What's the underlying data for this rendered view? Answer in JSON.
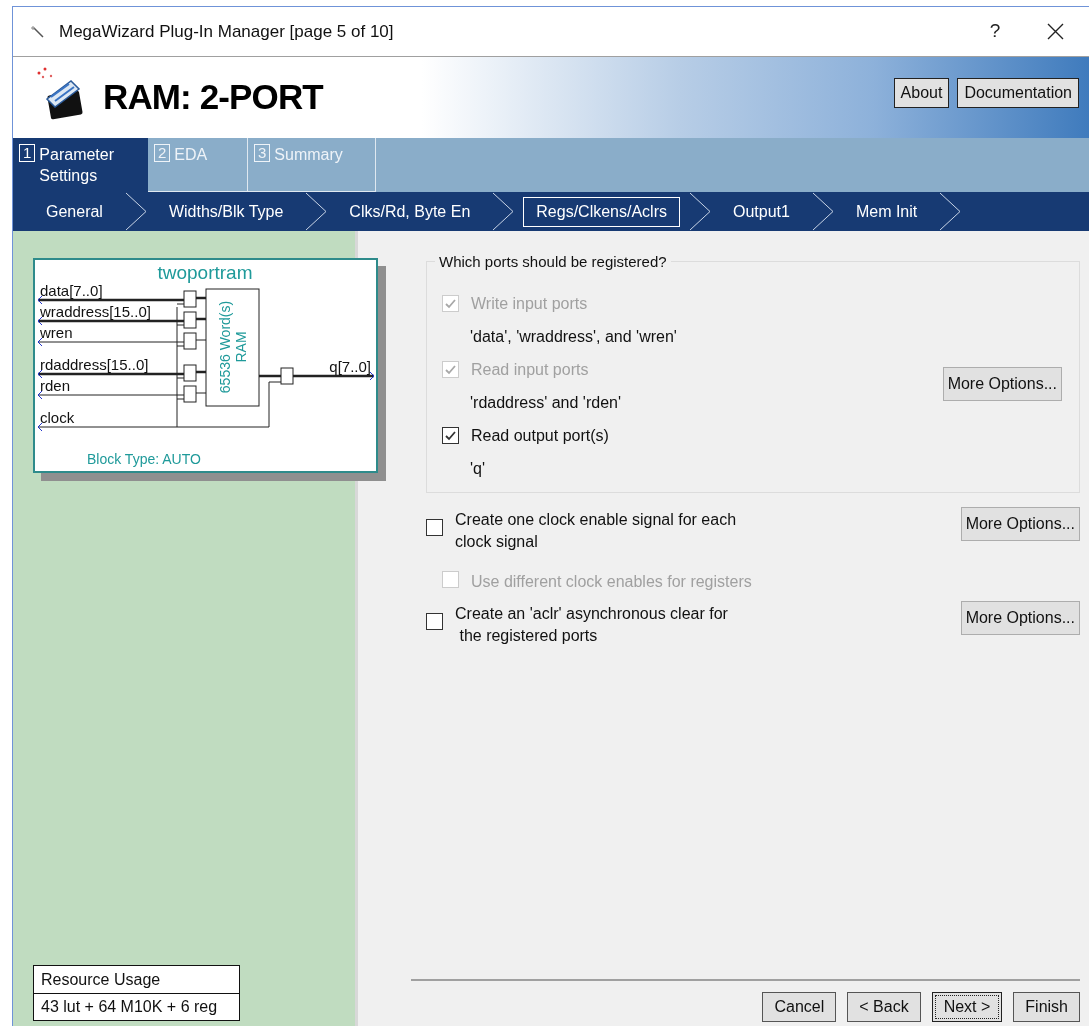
{
  "window": {
    "title": "MegaWizard Plug-In Manager [page 5 of 10]",
    "help": "?"
  },
  "header": {
    "title": "RAM: 2-PORT",
    "buttons": [
      "About",
      "Documentation"
    ]
  },
  "tabs": [
    {
      "number": "1",
      "label": "Parameter Settings",
      "selected": true
    },
    {
      "number": "2",
      "label": "EDA",
      "selected": false
    },
    {
      "number": "3",
      "label": "Summary",
      "selected": false
    }
  ],
  "steps": [
    {
      "label": "General",
      "selected": false
    },
    {
      "label": "Widths/Blk Type",
      "selected": false
    },
    {
      "label": "Clks/Rd, Byte En",
      "selected": false
    },
    {
      "label": "Regs/Clkens/Aclrs",
      "selected": true
    },
    {
      "label": "Output1",
      "selected": false
    },
    {
      "label": "Mem Init",
      "selected": false
    }
  ],
  "diagram": {
    "title": "twoportram",
    "inputs": [
      {
        "label": "data[7..0]",
        "kind": "bus"
      },
      {
        "label": "wraddress[15..0]",
        "kind": "bus"
      },
      {
        "label": "wren",
        "kind": "control"
      },
      {
        "label": "rdaddress[15..0]",
        "kind": "bus"
      },
      {
        "label": "rden",
        "kind": "control"
      },
      {
        "label": "clock",
        "kind": "clock"
      }
    ],
    "output": "q[7..0]",
    "ram_lines": [
      "65536 Word(s)",
      "RAM"
    ],
    "block_type": "Block Type: AUTO"
  },
  "registered_group": {
    "title": "Which ports should be registered?",
    "options": [
      {
        "label": "Write input ports",
        "checked": true,
        "disabled": true,
        "detail": "'data', 'wraddress', and 'wren'"
      },
      {
        "label": "Read input ports",
        "checked": true,
        "disabled": true,
        "detail": "'rdaddress' and 'rden'"
      },
      {
        "label": "Read output port(s)",
        "checked": true,
        "disabled": false,
        "detail": "'q'"
      }
    ],
    "button": "More Options..."
  },
  "options": [
    {
      "kind": "main",
      "lines": [
        "Create one clock enable signal for each",
        "clock signal"
      ],
      "checked": false,
      "disabled": false,
      "button": "More Options..."
    },
    {
      "kind": "sub",
      "lines": [
        "Use different clock enables for registers"
      ],
      "checked": false,
      "disabled": true
    },
    {
      "kind": "main",
      "lines": [
        "Create an 'aclr' asynchronous clear for",
        " the registered ports"
      ],
      "checked": false,
      "disabled": false,
      "button": "More Options..."
    }
  ],
  "resource": {
    "title": "Resource Usage",
    "value": "43 lut + 64 M10K + 6 reg"
  },
  "footer_buttons": [
    {
      "label": "Cancel",
      "focused": false
    },
    {
      "label": "< Back",
      "focused": false
    },
    {
      "label": "Next >",
      "focused": true
    },
    {
      "label": "Finish",
      "focused": false
    }
  ]
}
